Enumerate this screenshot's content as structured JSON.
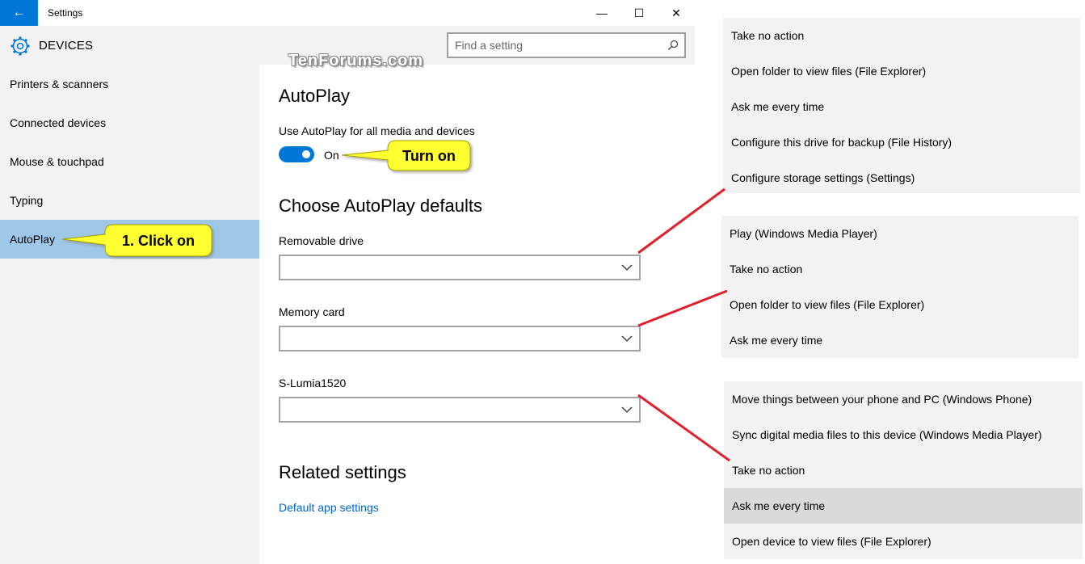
{
  "window": {
    "title": "Settings",
    "back_glyph": "←",
    "min_glyph": "—",
    "max_glyph": "☐",
    "close_glyph": "✕"
  },
  "header": {
    "section_title": "DEVICES",
    "search_placeholder": "Find a setting"
  },
  "watermark": "TenForums.com",
  "sidebar": {
    "items": [
      {
        "label": "Printers & scanners"
      },
      {
        "label": "Connected devices"
      },
      {
        "label": "Mouse & touchpad"
      },
      {
        "label": "Typing"
      },
      {
        "label": "AutoPlay",
        "active": true
      }
    ]
  },
  "main": {
    "title": "AutoPlay",
    "toggle_label": "Use AutoPlay for all media and devices",
    "toggle_state": "On",
    "defaults_title": "Choose AutoPlay defaults",
    "dropdowns": [
      {
        "label": "Removable drive",
        "value": ""
      },
      {
        "label": "Memory card",
        "value": ""
      },
      {
        "label": "S-Lumia1520",
        "value": ""
      }
    ],
    "related_title": "Related settings",
    "related_link": "Default app settings"
  },
  "callouts": {
    "turn_on": "Turn on",
    "click_on": "1. Click on"
  },
  "panels": [
    {
      "options": [
        "Take no action",
        "Open folder to view files (File Explorer)",
        "Ask me every time",
        "Configure this drive for backup (File History)",
        "Configure storage settings (Settings)"
      ]
    },
    {
      "options": [
        "Play (Windows Media Player)",
        "Take no action",
        "Open folder to view files (File Explorer)",
        "Ask me every time"
      ]
    },
    {
      "options": [
        "Move things between your phone and PC (Windows Phone)",
        "Sync digital media files to this device (Windows Media Player)",
        "Take no action",
        "Ask me every time",
        "Open device to view files (File Explorer)"
      ],
      "highlighted_index": 3
    }
  ],
  "colors": {
    "accent": "#0078d7",
    "callout_fill": "#ffff33",
    "connector_line": "#e0202a",
    "link": "#0066cc"
  }
}
